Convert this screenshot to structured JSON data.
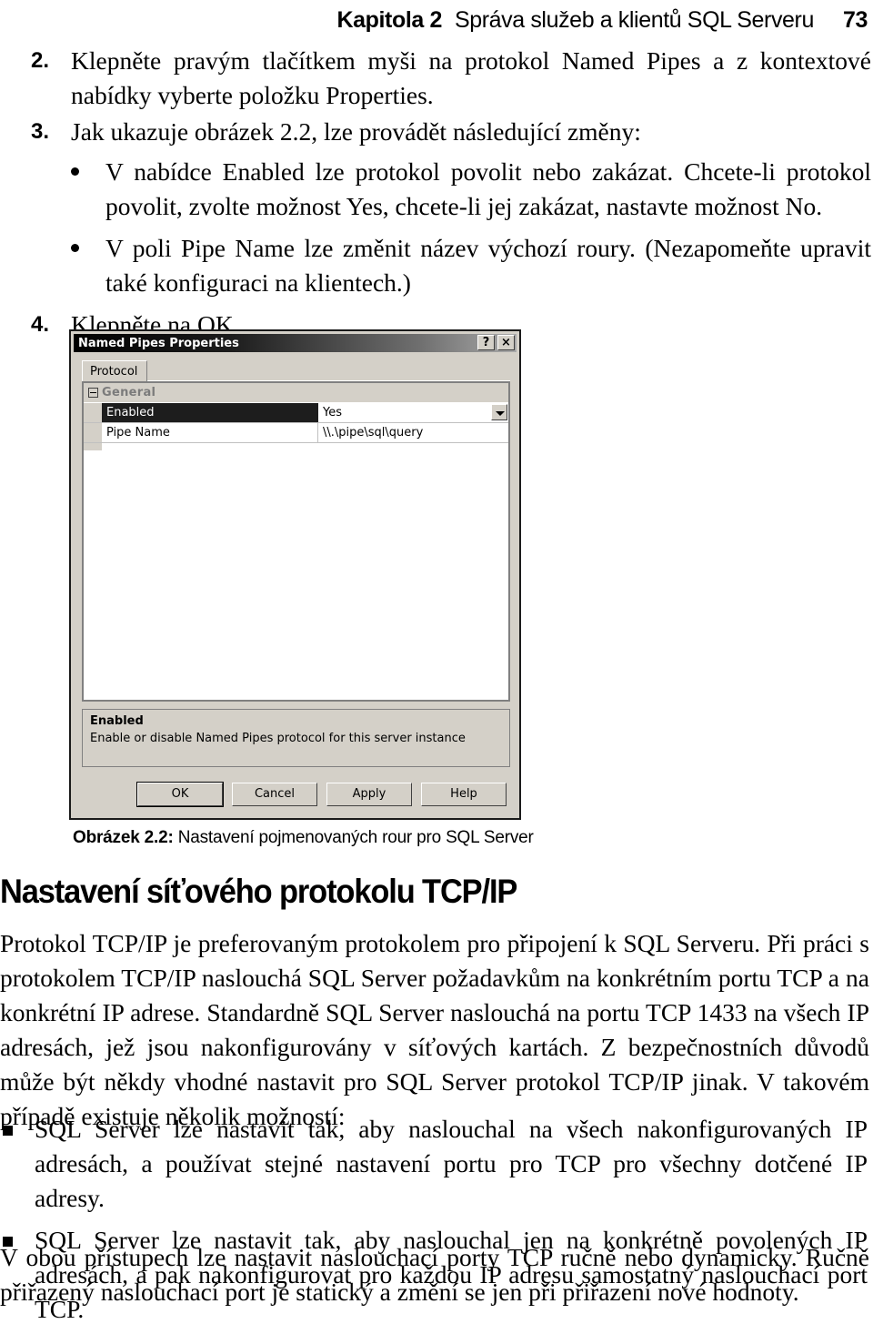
{
  "running_head": {
    "chapter": "Kapitola 2",
    "title": "Správa služeb a klientů SQL Serveru",
    "page_number": "73"
  },
  "steps": [
    {
      "number": "2.",
      "text": "Klepněte pravým tlačítkem myši na protokol Named Pipes a z kontextové nabídky vyberte položku Properties."
    },
    {
      "number": "3.",
      "text": "Jak ukazuje obrázek 2.2, lze provádět následující změny:"
    }
  ],
  "sub_bullets": [
    "V nabídce Enabled lze protokol povolit nebo zakázat. Chcete-li protokol povolit, zvolte možnost Yes, chcete-li jej zakázat, nastavte možnost No.",
    "V poli Pipe Name lze změnit název výchozí roury. (Nezapomeňte upravit také konfiguraci na klientech.)"
  ],
  "step_final": {
    "number": "4.",
    "text": "Klepněte na OK."
  },
  "dialog": {
    "title": "Named Pipes Properties",
    "help_button": "?",
    "close_button": "×",
    "tab": "Protocol",
    "group_label": "General",
    "rows": [
      {
        "label": "Enabled",
        "value": "Yes",
        "selected": true,
        "has_dropdown": true
      },
      {
        "label": "Pipe Name",
        "value": "\\\\.\\pipe\\sql\\query",
        "selected": false,
        "has_dropdown": false
      }
    ],
    "description": {
      "title": "Enabled",
      "body": "Enable or disable Named Pipes protocol for this server instance"
    },
    "buttons": [
      "OK",
      "Cancel",
      "Apply",
      "Help"
    ],
    "colors": {
      "face": "#d4d0c8",
      "titlebar_start": "#000000",
      "titlebar_end": "#a9a9a9",
      "selected_row": "#1d1d1d",
      "group_text": "#7b7b7b"
    }
  },
  "caption": {
    "label": "Obrázek 2.2:",
    "text": " Nastavení pojmenovaných rour pro SQL Server"
  },
  "section_heading": "Nastavení síťového protokolu TCP/IP",
  "paragraphs": {
    "p1": "Protokol TCP/IP je preferovaným protokolem pro připojení k SQL Serveru. Při práci s protokolem TCP/IP naslouchá SQL Server požadavkům na konkrétním portu TCP a na konkrétní IP adrese. Standardně SQL Server naslouchá na portu TCP 1433 na všech IP adresách, jež jsou nakonfigurovány v síťových kartách. Z bezpečnostních důvodů může být někdy vhodné nastavit pro SQL Server protokol TCP/IP jinak. V takovém případě existuje několik možností:",
    "p3": "V obou přístupech lze nastavit naslouchací porty TCP ručně nebo dynamicky. Ručně přiřazený naslouchací port je statický a změní se jen při přiřazení nové hodnoty."
  },
  "square_bullets": [
    "SQL Server lze nastavit tak, aby naslouchal na všech nakonfigurovaných IP adresách, a používat stejné nastavení portu pro TCP pro všechny dotčené IP adresy.",
    "SQL Server lze nastavit tak, aby naslouchal jen na konkrétně povolených IP adresách, a pak nakonfigurovat pro každou IP adresu samostatný naslouchací port TCP."
  ]
}
